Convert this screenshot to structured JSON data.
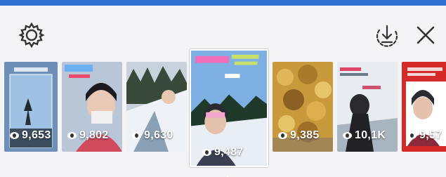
{
  "toolbar": {
    "settings_icon": "gear-icon",
    "download_icon": "download-circle-icon",
    "close_icon": "close-icon"
  },
  "stories": [
    {
      "views": "9,653"
    },
    {
      "views": "9,802"
    },
    {
      "views": "9,630"
    },
    {
      "views": "9,487",
      "selected": true
    },
    {
      "views": "9,385"
    },
    {
      "views": "10,1K"
    },
    {
      "views": "9,57"
    }
  ],
  "colors": {
    "top_strip": "#2f6fd0",
    "panel": "#f4f4f6",
    "icon": "#333333"
  }
}
